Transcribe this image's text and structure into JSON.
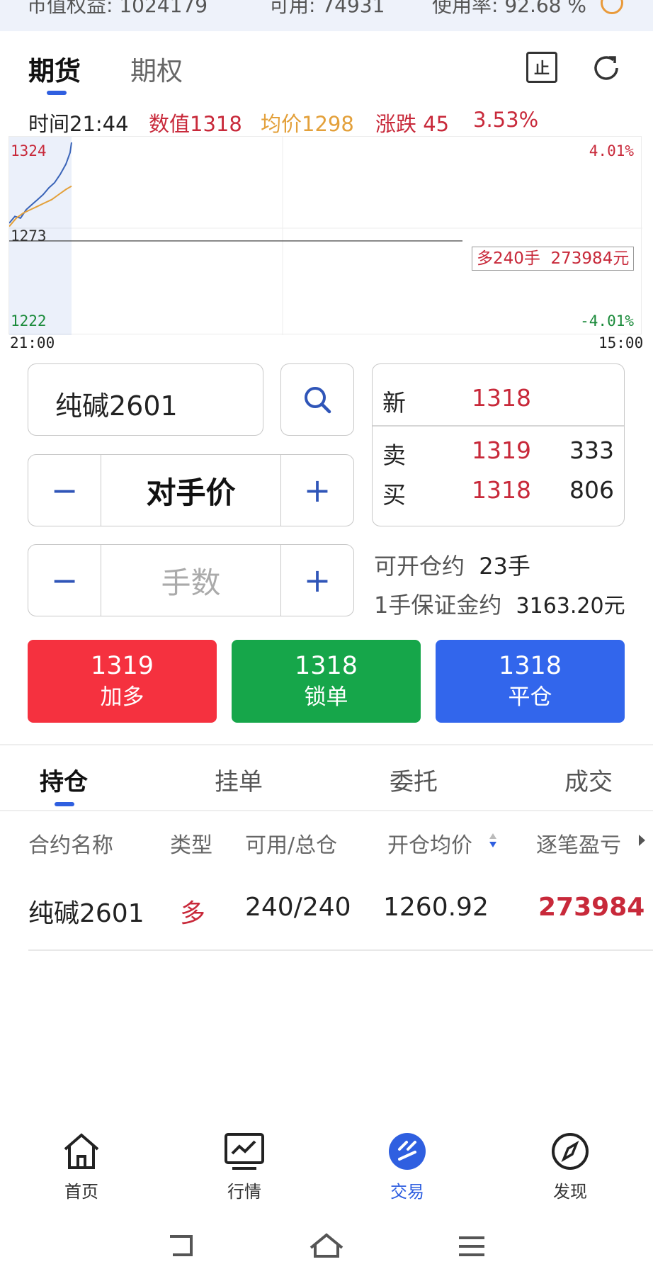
{
  "topbar": {
    "equity": "市值权益: 1024179",
    "available": "可用: 74931",
    "usage": "使用率: 92.68 %"
  },
  "tabs": [
    "期货",
    "期权"
  ],
  "header_icons": [
    "stop-icon",
    "refresh-icon"
  ],
  "stop_glyph": "止",
  "info": {
    "time": "时间21:44",
    "value": "数值1318",
    "avg": "均价1298",
    "change": "涨跌 45",
    "pct": "3.53%"
  },
  "chart_data": {
    "type": "line",
    "y_high": "1324",
    "y_mid": "1273",
    "y_low": "1222",
    "pct_high": "4.01%",
    "pct_low": "-4.01%",
    "x_start": "21:00",
    "x_end": "15:00",
    "ylim": [
      1222,
      1324
    ],
    "position_label": "多240手  273984元",
    "series": [
      {
        "name": "数值",
        "color": "#3a64b8",
        "x": [
          "21:00",
          "21:04",
          "21:08",
          "21:12",
          "21:16",
          "21:20",
          "21:24",
          "21:28",
          "21:32",
          "21:36",
          "21:40",
          "21:43",
          "21:44"
        ],
        "values": [
          1276,
          1280,
          1279,
          1284,
          1287,
          1290,
          1293,
          1297,
          1300,
          1305,
          1311,
          1318,
          1324
        ]
      },
      {
        "name": "均价",
        "color": "#e3a03a",
        "x": [
          "21:00",
          "21:05",
          "21:10",
          "21:15",
          "21:20",
          "21:25",
          "21:30",
          "21:35",
          "21:40",
          "21:44"
        ],
        "values": [
          1274,
          1279,
          1282,
          1284,
          1286,
          1288,
          1290,
          1293,
          1296,
          1298
        ]
      }
    ]
  },
  "contract": {
    "name": "纯碱2601"
  },
  "price_mode": "对手价",
  "qty_placeholder": "手数",
  "quote": {
    "new_label": "新",
    "new_price": "1318",
    "sell_label": "卖",
    "sell_price": "1319",
    "sell_vol": "333",
    "buy_label": "买",
    "buy_price": "1318",
    "buy_vol": "806"
  },
  "open_info": {
    "can_open_label": "可开仓约",
    "can_open_value": "23手",
    "margin_label": "1手保证金约",
    "margin_value": "3163.20元"
  },
  "actions": [
    {
      "price": "1319",
      "label": "加多",
      "color": "#f5313f"
    },
    {
      "price": "1318",
      "label": "锁单",
      "color": "#16a64a"
    },
    {
      "price": "1318",
      "label": "平仓",
      "color": "#3266ec"
    }
  ],
  "pos_tabs": [
    "持仓",
    "挂单",
    "委托",
    "成交"
  ],
  "columns": [
    "合约名称",
    "类型",
    "可用/总仓",
    "开仓均价",
    "逐笔盈亏"
  ],
  "positions": [
    {
      "name": "纯碱2601",
      "type": "多",
      "qty": "240/240",
      "avg": "1260.92",
      "pnl": "273984"
    }
  ],
  "nav": [
    {
      "label": "首页",
      "icon": "home-icon"
    },
    {
      "label": "行情",
      "icon": "market-icon"
    },
    {
      "label": "交易",
      "icon": "trade-icon"
    },
    {
      "label": "发现",
      "icon": "compass-icon"
    }
  ],
  "accent": "#2f5fe0"
}
